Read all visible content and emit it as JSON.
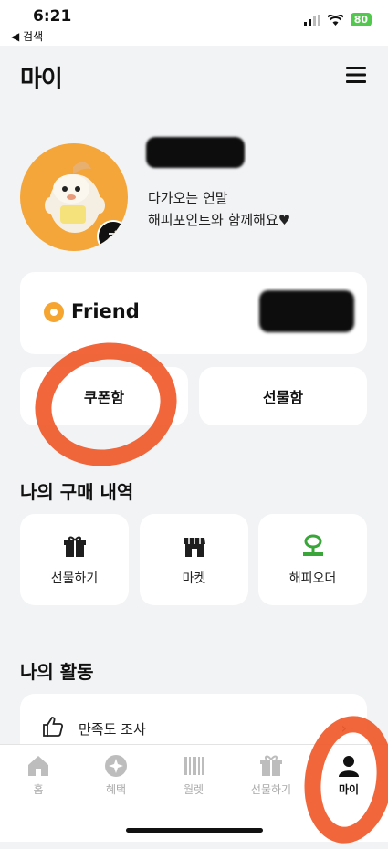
{
  "status_bar": {
    "time": "6:21",
    "back_label": "◀ 검색",
    "battery": "80"
  },
  "header": {
    "title": "마이"
  },
  "profile": {
    "greeting_line1": "다가오는 연말",
    "greeting_line2": "해피포인트와 함께해요♥"
  },
  "membership": {
    "grade": "Friend"
  },
  "buttons": {
    "coupon": "쿠폰함",
    "gift_box": "선물함"
  },
  "purchase": {
    "title": "나의 구매 내역",
    "tiles": [
      {
        "label": "선물하기",
        "icon": "gift-icon"
      },
      {
        "label": "마켓",
        "icon": "store-icon"
      },
      {
        "label": "해피오더",
        "icon": "happy-order-icon"
      }
    ]
  },
  "activity": {
    "title": "나의 활동",
    "items": [
      {
        "label": "만족도 조사",
        "icon": "thumbs-up-icon"
      }
    ]
  },
  "tabs": [
    {
      "label": "홈",
      "icon": "home-icon"
    },
    {
      "label": "혜택",
      "icon": "benefit-icon"
    },
    {
      "label": "월렛",
      "icon": "wallet-icon"
    },
    {
      "label": "선물하기",
      "icon": "gift-icon"
    },
    {
      "label": "마이",
      "icon": "person-icon",
      "active": true
    }
  ],
  "colors": {
    "accent_orange": "#f6a531",
    "annotation": "#f05a2a",
    "order_green": "#3aa63a"
  }
}
